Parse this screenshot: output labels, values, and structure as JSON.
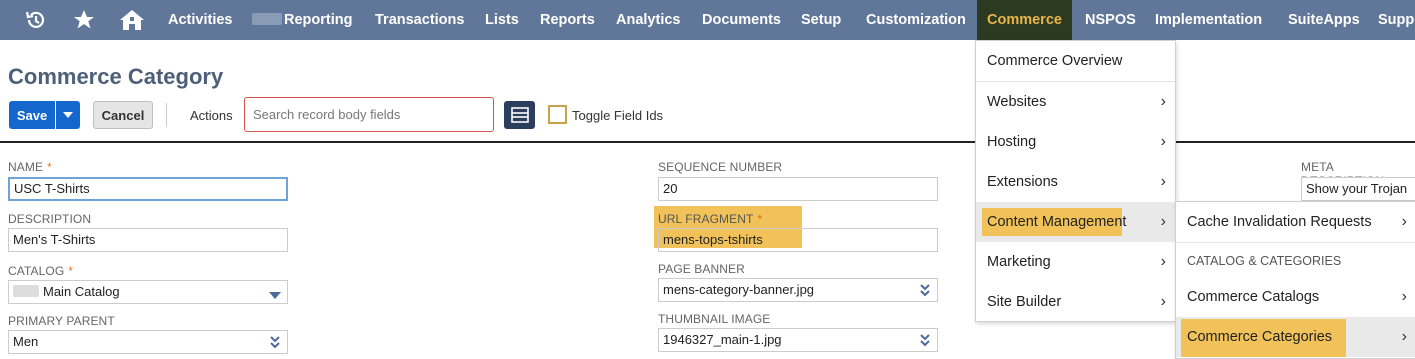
{
  "nav": {
    "icons": [
      "recent-icon",
      "star-icon",
      "home-icon"
    ],
    "items": [
      "Activities",
      "Reporting",
      "Transactions",
      "Lists",
      "Reports",
      "Analytics",
      "Documents",
      "Setup",
      "Customization",
      "Commerce",
      "NSPOS",
      "Implementation",
      "SuiteApps",
      "Suppo"
    ],
    "active": "Commerce",
    "bg_color": "#607799",
    "active_bg": "#2d3a22",
    "active_color": "#e8b64a"
  },
  "header": {
    "title": "Commerce Category",
    "save_label": "Save",
    "cancel_label": "Cancel",
    "actions_label": "Actions",
    "search_placeholder": "Search record body fields",
    "toggle_label": "Toggle Field Ids"
  },
  "form": {
    "name_label": "NAME",
    "name_value": "USC T-Shirts",
    "description_label": "DESCRIPTION",
    "description_value": "Men's T-Shirts",
    "catalog_label": "CATALOG",
    "catalog_value": "Main Catalog",
    "primary_parent_label": "PRIMARY PARENT",
    "primary_parent_value": "Men",
    "sequence_label": "SEQUENCE NUMBER",
    "sequence_value": "20",
    "url_fragment_label": "URL FRAGMENT",
    "url_fragment_value": "mens-tops-tshirts",
    "page_banner_label": "PAGE BANNER",
    "page_banner_value": "mens-category-banner.jpg",
    "thumbnail_label": "THUMBNAIL IMAGE",
    "thumbnail_value": "1946327_main-1.jpg",
    "meta_label": "META DESCRIPTION",
    "meta_value": "Show your Trojan",
    "required_mark": "*"
  },
  "commerce_menu": {
    "overview": "Commerce Overview",
    "items": [
      "Websites",
      "Hosting",
      "Extensions",
      "Content Management",
      "Marketing",
      "Site Builder"
    ],
    "highlighted": "Content Management"
  },
  "content_submenu": {
    "top_item": "Cache Invalidation Requests",
    "section_header": "CATALOG & CATEGORIES",
    "items": [
      "Commerce Catalogs",
      "Commerce Categories"
    ],
    "highlighted": "Commerce Categories"
  },
  "colors": {
    "highlight": "#f0c259",
    "primary_button": "#1467cc",
    "title": "#4d5f79"
  }
}
